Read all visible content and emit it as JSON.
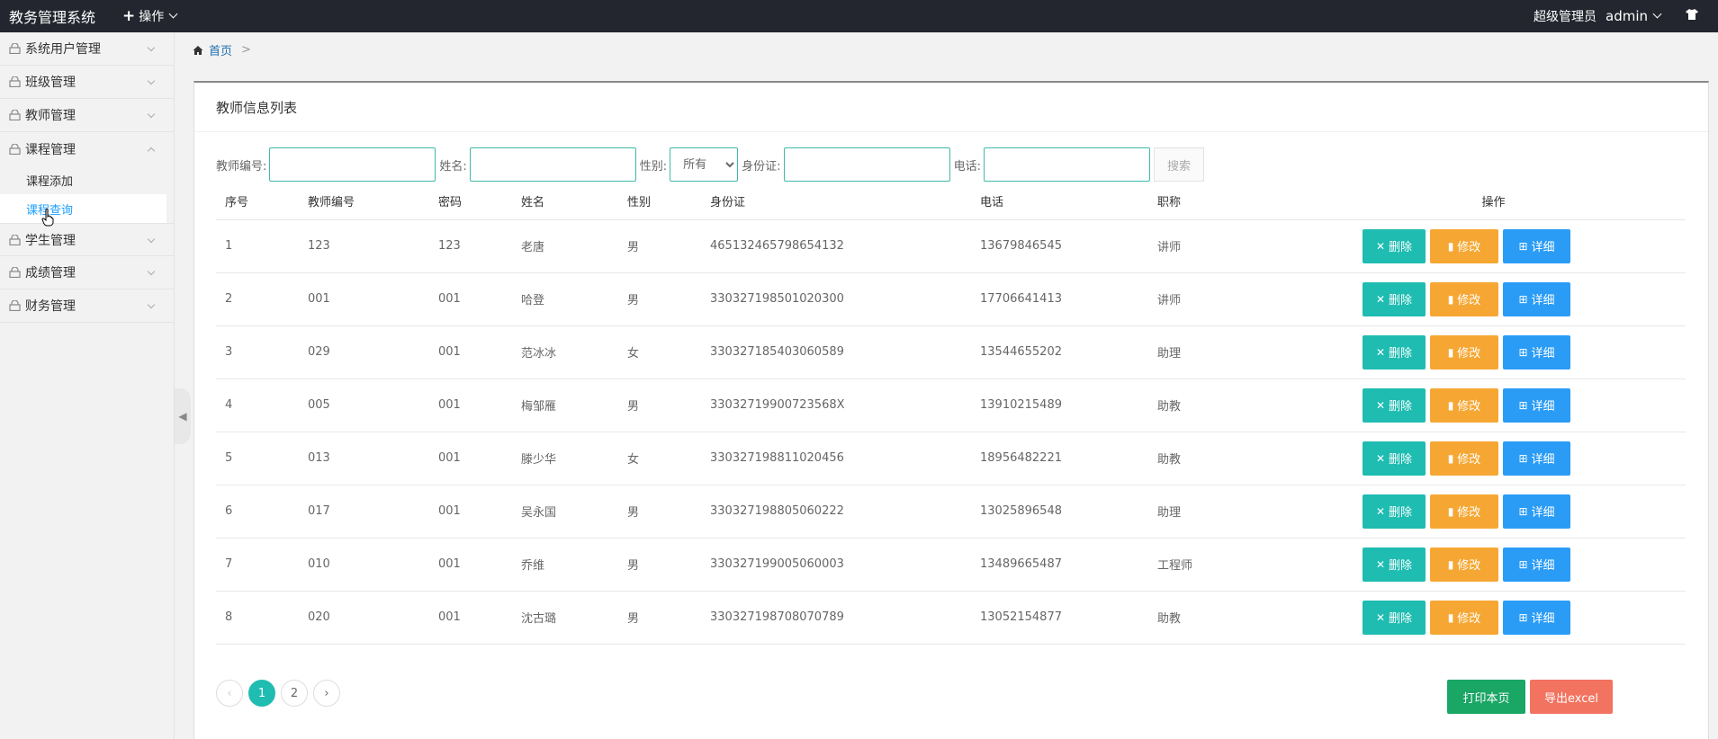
{
  "header": {
    "brand": "教务管理系统",
    "ops_label": "操作",
    "role": "超级管理员",
    "user": "admin"
  },
  "sidebar": {
    "items": [
      {
        "label": "系统用户管理"
      },
      {
        "label": "班级管理"
      },
      {
        "label": "教师管理"
      },
      {
        "label": "课程管理"
      },
      {
        "label": "学生管理"
      },
      {
        "label": "成绩管理"
      },
      {
        "label": "财务管理"
      }
    ],
    "subitems": [
      {
        "label": "课程添加"
      },
      {
        "label": "课程查询"
      }
    ]
  },
  "breadcrumb": {
    "home": "首页",
    "separator": ">"
  },
  "panel": {
    "title": "教师信息列表"
  },
  "search": {
    "teacher_no_label": "教师编号:",
    "name_label": "姓名:",
    "gender_label": "性别:",
    "gender_value": "所有",
    "id_label": "身份证:",
    "phone_label": "电话:",
    "search_button": "搜索"
  },
  "table": {
    "headers": [
      "序号",
      "教师编号",
      "密码",
      "姓名",
      "性别",
      "身份证",
      "电话",
      "职称",
      "操作"
    ],
    "rows": [
      [
        "1",
        "123",
        "123",
        "老唐",
        "男",
        "465132465798654132",
        "13679846545",
        "讲师"
      ],
      [
        "2",
        "001",
        "001",
        "哈登",
        "男",
        "330327198501020300",
        "17706641413",
        "讲师"
      ],
      [
        "3",
        "029",
        "001",
        "范冰冰",
        "女",
        "330327185403060589",
        "13544655202",
        "助理"
      ],
      [
        "4",
        "005",
        "001",
        "梅邹雁",
        "男",
        "33032719900723568X",
        "13910215489",
        "助教"
      ],
      [
        "5",
        "013",
        "001",
        "滕少华",
        "女",
        "330327198811020456",
        "18956482221",
        "助教"
      ],
      [
        "6",
        "017",
        "001",
        "吴永国",
        "男",
        "330327198805060222",
        "13025896548",
        "助理"
      ],
      [
        "7",
        "010",
        "001",
        "乔维",
        "男",
        "330327199005060003",
        "13489665487",
        "工程师"
      ],
      [
        "8",
        "020",
        "001",
        "沈古璐",
        "男",
        "330327198708070789",
        "13052154877",
        "助教"
      ]
    ],
    "actions": {
      "delete": "删除",
      "edit": "修改",
      "detail": "详细"
    }
  },
  "pagination": {
    "prev": "‹",
    "pages": [
      "1",
      "2"
    ],
    "next": "›"
  },
  "footer_buttons": {
    "print": "打印本页",
    "export": "导出excel"
  },
  "colors": {
    "topbar": "#23262e",
    "delete": "#1fbcb1",
    "edit": "#f6a733",
    "detail": "#2a9cf6",
    "print": "#1aa664",
    "export": "#f2735f",
    "link": "#1e9fff"
  }
}
